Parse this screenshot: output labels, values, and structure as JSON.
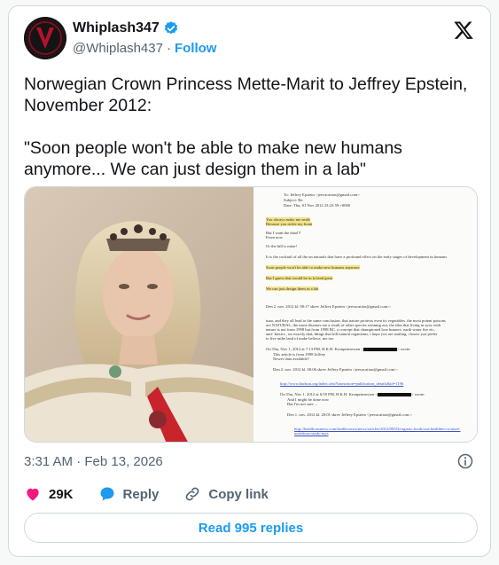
{
  "author": {
    "display_name": "Whiplash347",
    "handle": "@Whiplash437",
    "separator": "·",
    "follow_label": "Follow"
  },
  "tweet": {
    "text": "Norwegian Crown Princess Mette-Marit to Jeffrey Epstein, November 2012:\n\n\"Soon people won't be able to make new humans anymore... We can just design them in a lab\"",
    "timestamp": "3:31 AM · Feb 13, 2026"
  },
  "actions": {
    "likes": "29K",
    "reply_label": "Reply",
    "copy_link_label": "Copy link"
  },
  "read_replies_label": "Read 995 replies",
  "colors": {
    "accent": "#1d9bf0",
    "like": "#f91880",
    "muted": "#536471",
    "highlight": "#f3e38a"
  },
  "icons": {
    "verified": "verified-badge-icon",
    "brand": "x-logo-icon",
    "info": "info-icon",
    "like": "heart-icon",
    "reply": "speech-bubble-icon",
    "copy_link": "link-icon"
  },
  "document": {
    "to": "To: Jeffrey Epstein <jeevacation@gmail.com>",
    "subject": "Subject: Re:",
    "date": "Date: Thu, 01 Nov 2012 23:23:59 +0000",
    "lines": [
      "You always make me smile",
      "Because you tickle my brain",
      "But I want the data!!!",
      "From now",
      "Or the bill is mine!",
      "It is the cocktail of all the un naturals that have a profound effect on the early stages of development in humans",
      "Soon people won't be able to make new humans anymore",
      "But I guess that would be in la land great",
      "We can just design them in a lab",
      "Den 2. nov. 2012 kl. 00:17 skrev Jeffrey Epstein <jeevacation@gmail.com>:",
      "tuna, and they all lead to the same conclusion, that nature protects even its vegetables.   the most potent poisons",
      "are NATURAL,   the most diseases are a result of other species winning out, the idea that living in sync with",
      "nature is not from 1998 but from 1998 BC.    a concept that championed lose humors.  earth water fire etc,",
      "anti- biotics , no exactly that, things that kill natural organisms,     i hope you are smiling,   i know you prefer",
      "to live inthe land of make believe,   me too",
      "On Thu, Nov 1, 2012 at 7:13 PM, H.K.H. Kronprinsessen <",
      "> wrote:",
      "This article is from 1998 Jeffrey",
      "Newer data available?",
      "Den 2. nov. 2012 kl. 00:06 skrev Jeffrey Epstein <jeevacation@gmail.com>:",
      "http://www.hudson.org/index.cfm?fuseaction=publication_details&id=1196",
      "On Thu, Nov 1, 2012 at 6:59 PM, H.K.H. Kronprinsessen <",
      "> wrote:",
      "And I might be done now",
      "But I'm not sure ...",
      "Den 1. nov. 2012 kl. 20:01 skrev Jeffrey Epstein <jeevacation@gmail.com>:",
      "http://health.msnews.com/health-news/news/articles/2012/09/03/organic-foods-not-healthier-or-more-",
      "nutritious-study-says"
    ]
  }
}
